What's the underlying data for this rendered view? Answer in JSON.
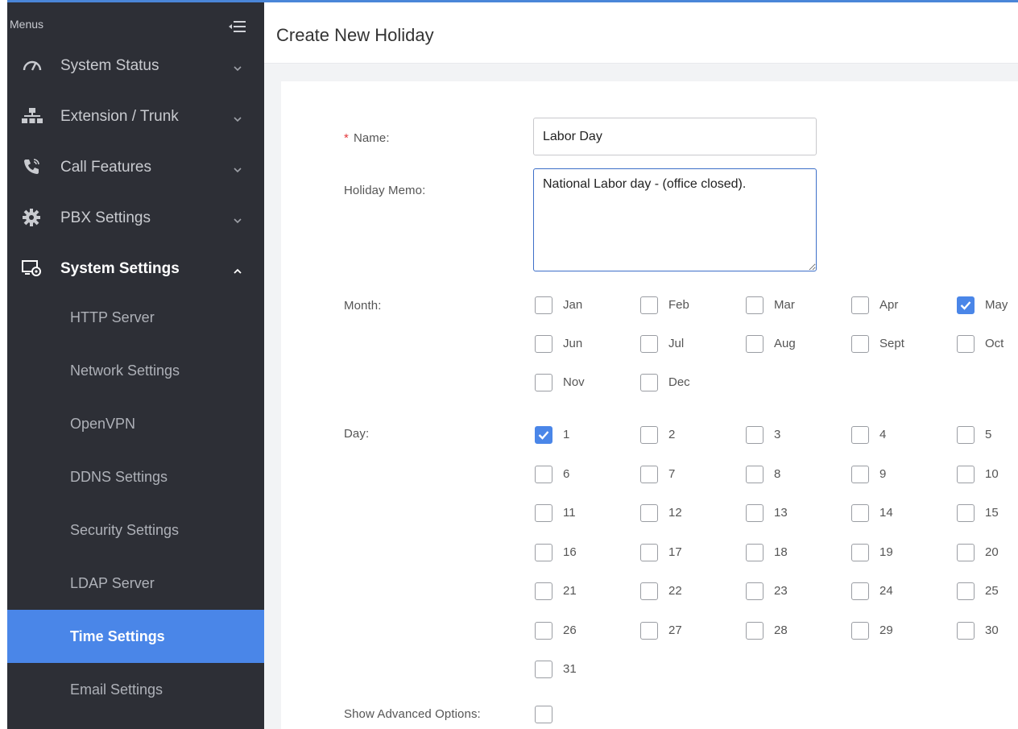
{
  "sidebar": {
    "menus_label": "Menus",
    "items": [
      {
        "name": "system-status",
        "label": "System Status",
        "icon": "gauge-icon",
        "expanded": false
      },
      {
        "name": "extension-trunk",
        "label": "Extension / Trunk",
        "icon": "network-icon",
        "expanded": false
      },
      {
        "name": "call-features",
        "label": "Call Features",
        "icon": "phone-icon",
        "expanded": false
      },
      {
        "name": "pbx-settings",
        "label": "PBX Settings",
        "icon": "gear-icon",
        "expanded": false
      },
      {
        "name": "system-settings",
        "label": "System Settings",
        "icon": "monitor-gear-icon",
        "expanded": true
      }
    ],
    "sub_items": [
      {
        "label": "HTTP Server",
        "active": false
      },
      {
        "label": "Network Settings",
        "active": false
      },
      {
        "label": "OpenVPN",
        "active": false
      },
      {
        "label": "DDNS Settings",
        "active": false
      },
      {
        "label": "Security Settings",
        "active": false
      },
      {
        "label": "LDAP Server",
        "active": false
      },
      {
        "label": "Time Settings",
        "active": true
      },
      {
        "label": "Email Settings",
        "active": false
      }
    ]
  },
  "page": {
    "title": "Create New Holiday"
  },
  "form": {
    "name_required_mark": "*",
    "name_label": "Name:",
    "name_value": "Labor Day",
    "memo_label": "Holiday Memo:",
    "memo_value": "National Labor day - (office closed).",
    "month_label": "Month:",
    "months": [
      {
        "label": "Jan",
        "checked": false
      },
      {
        "label": "Feb",
        "checked": false
      },
      {
        "label": "Mar",
        "checked": false
      },
      {
        "label": "Apr",
        "checked": false
      },
      {
        "label": "May",
        "checked": true
      },
      {
        "label": "Jun",
        "checked": false
      },
      {
        "label": "Jul",
        "checked": false
      },
      {
        "label": "Aug",
        "checked": false
      },
      {
        "label": "Sept",
        "checked": false
      },
      {
        "label": "Oct",
        "checked": false
      },
      {
        "label": "Nov",
        "checked": false
      },
      {
        "label": "Dec",
        "checked": false
      }
    ],
    "day_label": "Day:",
    "days": [
      {
        "label": "1",
        "checked": true
      },
      {
        "label": "2",
        "checked": false
      },
      {
        "label": "3",
        "checked": false
      },
      {
        "label": "4",
        "checked": false
      },
      {
        "label": "5",
        "checked": false
      },
      {
        "label": "6",
        "checked": false
      },
      {
        "label": "7",
        "checked": false
      },
      {
        "label": "8",
        "checked": false
      },
      {
        "label": "9",
        "checked": false
      },
      {
        "label": "10",
        "checked": false
      },
      {
        "label": "11",
        "checked": false
      },
      {
        "label": "12",
        "checked": false
      },
      {
        "label": "13",
        "checked": false
      },
      {
        "label": "14",
        "checked": false
      },
      {
        "label": "15",
        "checked": false
      },
      {
        "label": "16",
        "checked": false
      },
      {
        "label": "17",
        "checked": false
      },
      {
        "label": "18",
        "checked": false
      },
      {
        "label": "19",
        "checked": false
      },
      {
        "label": "20",
        "checked": false
      },
      {
        "label": "21",
        "checked": false
      },
      {
        "label": "22",
        "checked": false
      },
      {
        "label": "23",
        "checked": false
      },
      {
        "label": "24",
        "checked": false
      },
      {
        "label": "25",
        "checked": false
      },
      {
        "label": "26",
        "checked": false
      },
      {
        "label": "27",
        "checked": false
      },
      {
        "label": "28",
        "checked": false
      },
      {
        "label": "29",
        "checked": false
      },
      {
        "label": "30",
        "checked": false
      },
      {
        "label": "31",
        "checked": false
      }
    ],
    "advanced_label": "Show Advanced Options:",
    "advanced_checked": false
  },
  "colors": {
    "sidebar_bg": "#2d2f36",
    "accent": "#4a86e8",
    "required": "#e4393c"
  }
}
